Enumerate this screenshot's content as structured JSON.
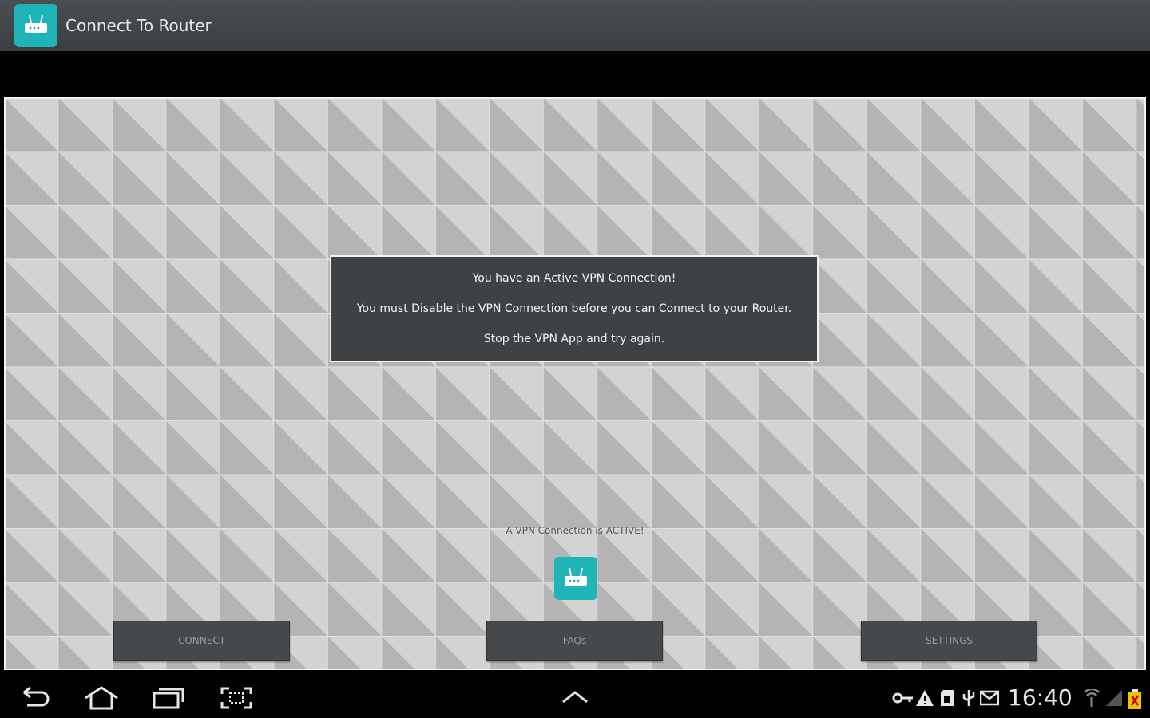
{
  "app": {
    "title": "Connect To Router",
    "icon": "router-icon",
    "accent_color": "#1fb5b8"
  },
  "dialog": {
    "line1": "You have an Active VPN Connection!",
    "line2": "You must Disable the VPN Connection before you can Connect to your Router.",
    "line3": "Stop the VPN App and try again."
  },
  "status": {
    "message": "A VPN Connection is ACTIVE!"
  },
  "buttons": {
    "connect": "CONNECT",
    "faqs": "FAQs",
    "settings": "SETTINGS"
  },
  "system_bar": {
    "clock": "16:40",
    "nav_icons": [
      "back-icon",
      "home-icon",
      "recent-apps-icon",
      "screenshot-icon",
      "chevron-up-icon"
    ],
    "status_icons": [
      "key-icon",
      "warning-icon",
      "sd-card-icon",
      "usb-icon",
      "mail-icon",
      "wifi-icon",
      "signal-icon",
      "battery-icon"
    ]
  }
}
